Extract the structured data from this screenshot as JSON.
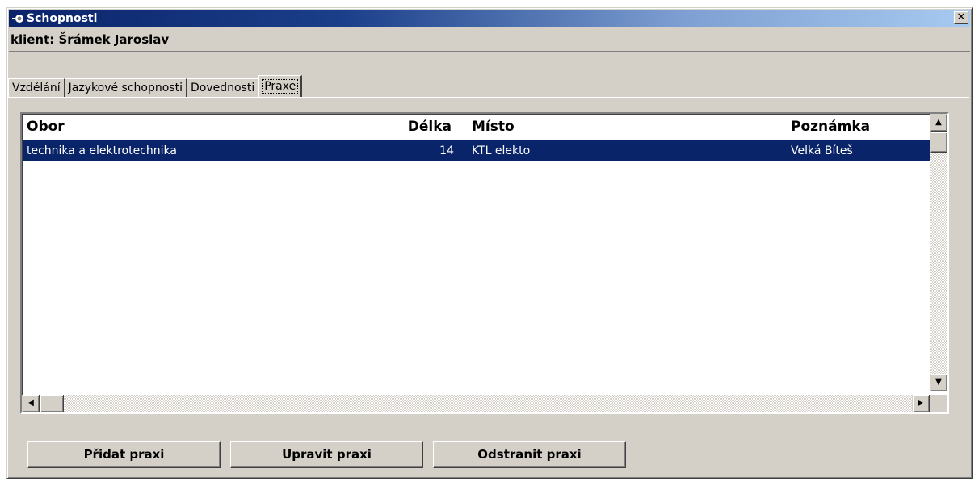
{
  "window": {
    "title": "Schopnosti",
    "close_glyph": "✕"
  },
  "client": {
    "label": "klient: Šrámek Jaroslav"
  },
  "tabs": [
    {
      "label": "Vzdělání"
    },
    {
      "label": "Jazykové schopnosti"
    },
    {
      "label": "Dovednosti"
    },
    {
      "label": "Praxe",
      "active": true
    }
  ],
  "list": {
    "columns": [
      "Obor",
      "Délka",
      "Místo",
      "Poznámka"
    ],
    "rows": [
      [
        "technika a elektrotechnika",
        "14",
        "KTL elekto",
        "Velká Bíteš"
      ]
    ]
  },
  "buttons": {
    "add": "Přidat praxi",
    "edit": "Upravit praxi",
    "remove": "Odstranit praxi"
  },
  "icons": {
    "title": "app-icon",
    "scroll_up": "arrow-up-icon",
    "scroll_down": "arrow-down-icon",
    "scroll_left": "arrow-left-icon",
    "scroll_right": "arrow-right-icon"
  },
  "colors": {
    "selection": "#0a246a",
    "face": "#d4d0c8"
  }
}
